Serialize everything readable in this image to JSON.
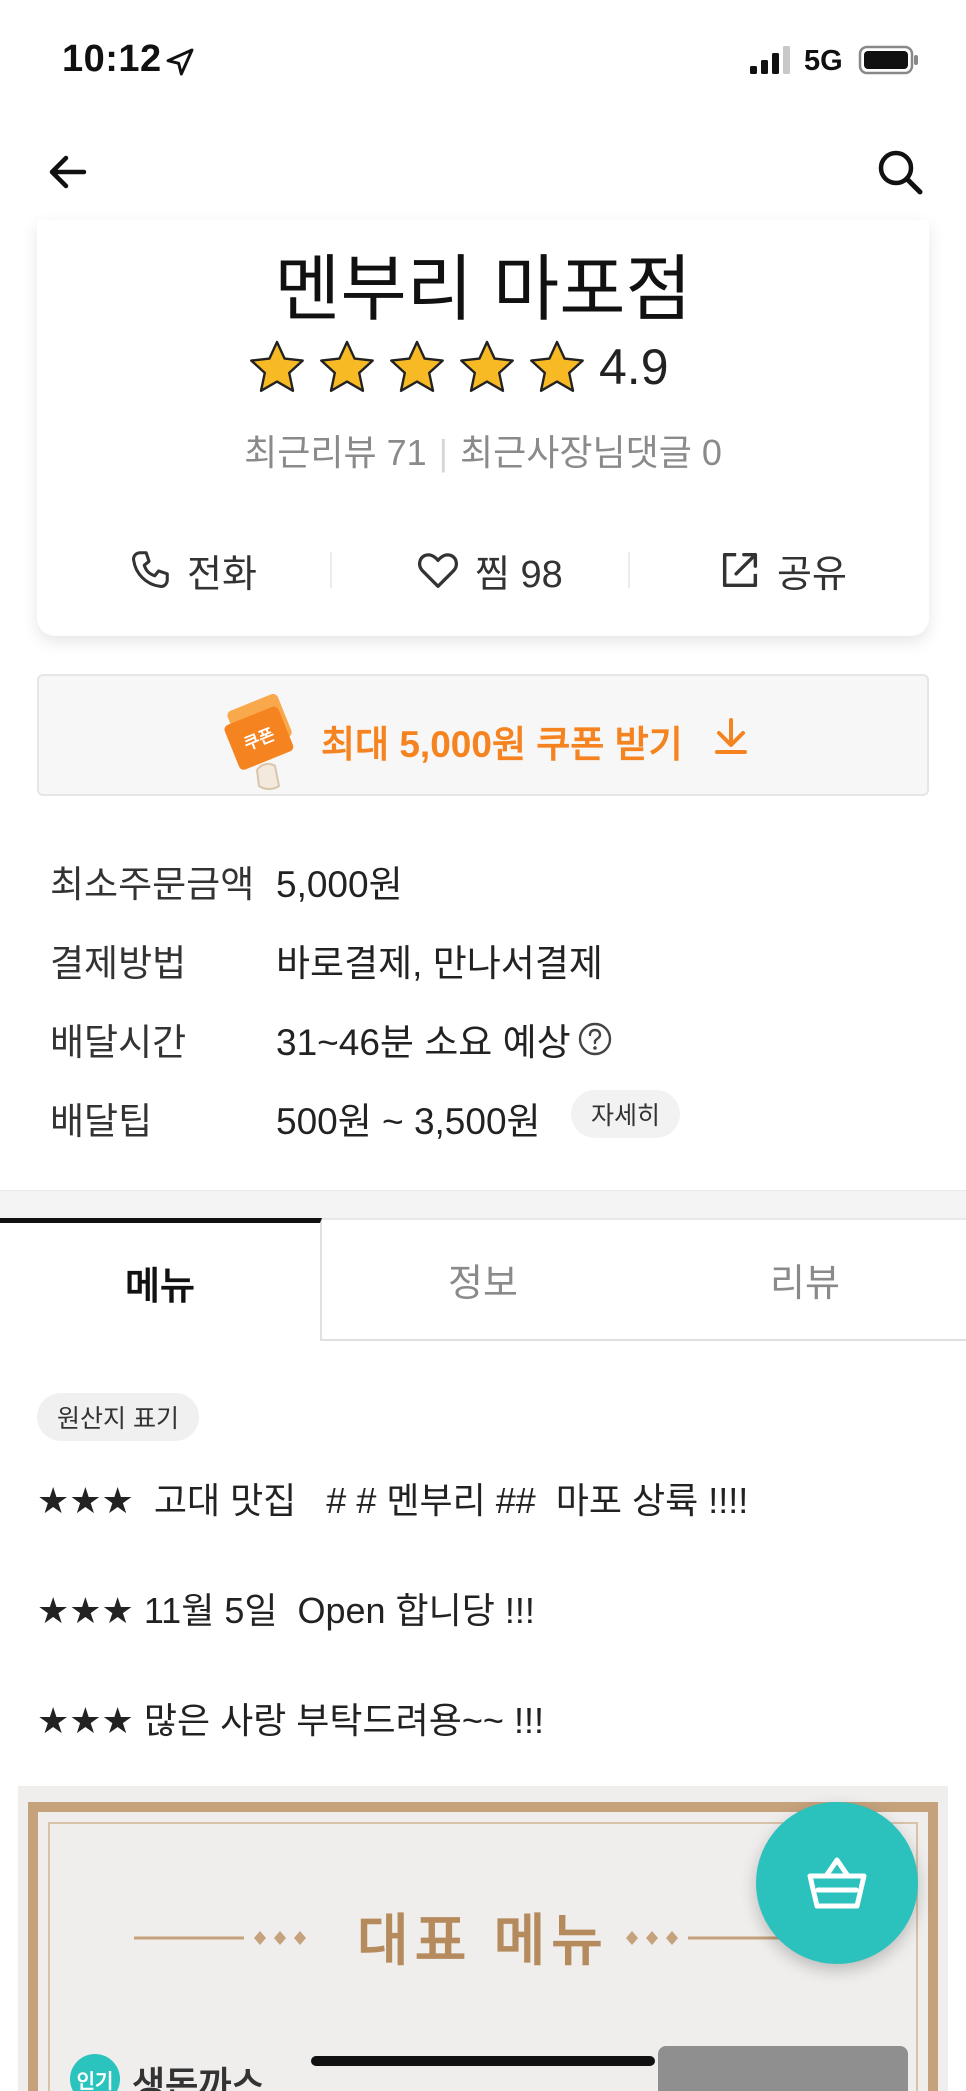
{
  "status_bar": {
    "time": "10:12",
    "network": "5G",
    "icons": [
      "location-arrow-icon",
      "signal-icon",
      "battery-icon"
    ]
  },
  "nav": {
    "icons": [
      "back-arrow-icon",
      "search-icon"
    ]
  },
  "store": {
    "name": "멘부리 마포점",
    "rating": "4.9",
    "star_count": 5,
    "recent_reviews": "최근리뷰 71",
    "recent_owner_comments": "최근사장님댓글 0",
    "actions": {
      "call": "전화",
      "like": "찜 98",
      "share": "공유"
    }
  },
  "coupon": {
    "label": "최대 5,000원 쿠폰 받기",
    "ticket_text": "쿠폰",
    "accent": "#f5831f"
  },
  "info": {
    "min_order": {
      "label": "최소주문금액",
      "value": "5,000원"
    },
    "payment": {
      "label": "결제방법",
      "value": "바로결제, 만나서결제"
    },
    "delivery_time": {
      "label": "배달시간",
      "value": "31~46분 소요 예상"
    },
    "delivery_tip": {
      "label": "배달팁",
      "value": "500원 ~ 3,500원",
      "detail": "자세히"
    }
  },
  "tabs": {
    "menu": "메뉴",
    "info": "정보",
    "review": "리뷰",
    "active": "메뉴"
  },
  "origin_chip": "원산지 표기",
  "notices": [
    "★★★  고대 맛집   # # 멘부리 ##  마포 상륙 !!!!",
    "★★★ 11월 5일  Open 합니당 !!!",
    "★★★ 많은 사랑 부탁드려용~~ !!!"
  ],
  "banner": {
    "title": "대표 메뉴",
    "badge": "인기",
    "item_name": "생돈까스"
  },
  "colors": {
    "teal": "#2bc1bc",
    "gold": "#b58b5e",
    "star": "#f7b924"
  }
}
